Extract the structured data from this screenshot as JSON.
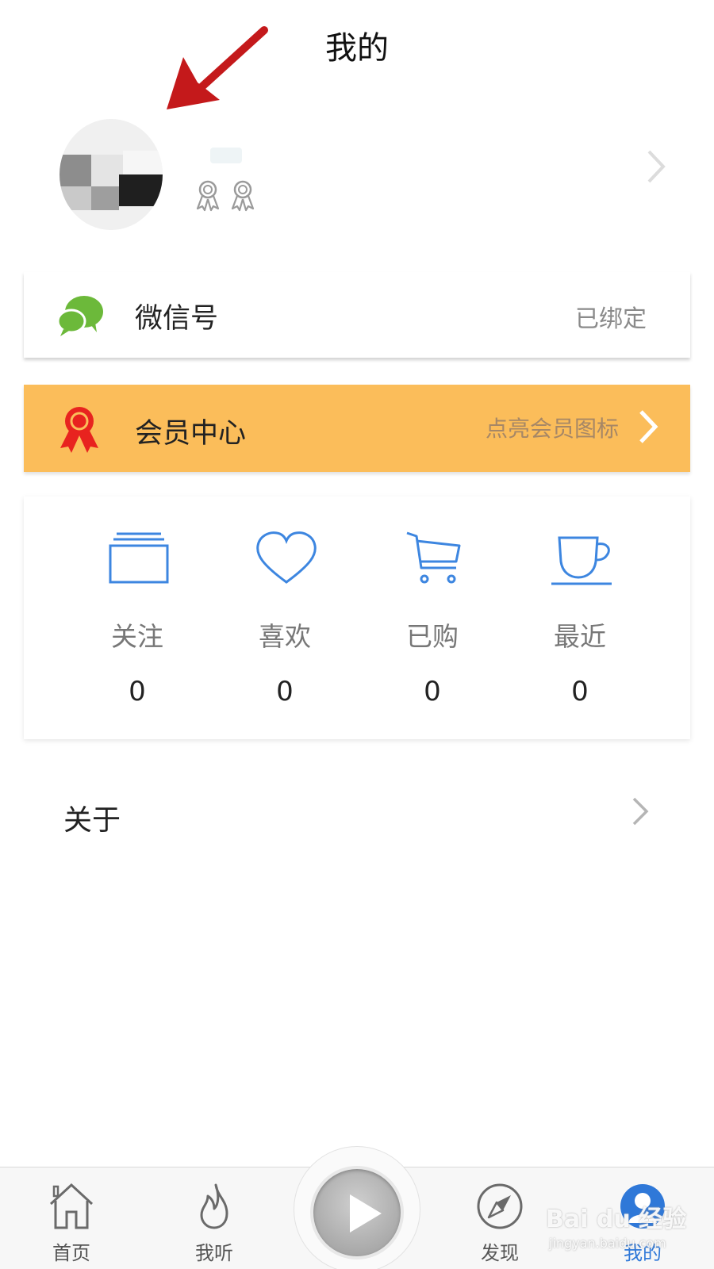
{
  "header": {
    "title": "我的"
  },
  "profile": {
    "username": "",
    "medal_count": 2
  },
  "wechat": {
    "label": "微信号",
    "status": "已绑定"
  },
  "vip": {
    "label": "会员中心",
    "hint": "点亮会员图标"
  },
  "stats": [
    {
      "icon": "folder-icon",
      "label": "关注",
      "count": "0"
    },
    {
      "icon": "heart-icon",
      "label": "喜欢",
      "count": "0"
    },
    {
      "icon": "cart-icon",
      "label": "已购",
      "count": "0"
    },
    {
      "icon": "cup-icon",
      "label": "最近",
      "count": "0"
    }
  ],
  "about": {
    "label": "关于"
  },
  "tabbar": {
    "tabs": [
      {
        "icon": "home-icon",
        "label": "首页"
      },
      {
        "icon": "flame-icon",
        "label": "我听"
      },
      {
        "icon": "compass-icon",
        "label": "发现"
      },
      {
        "icon": "user-icon",
        "label": "我的",
        "active": true
      }
    ],
    "play_icon": "play-icon"
  },
  "watermark": {
    "brand": "Bai du 经验",
    "url": "jingyan.baidu.com"
  },
  "colors": {
    "accent": "#2f78d8",
    "vip_bg": "#fbbd5a",
    "wechat_green": "#6cb93a",
    "arrow_red": "#c4191b"
  }
}
